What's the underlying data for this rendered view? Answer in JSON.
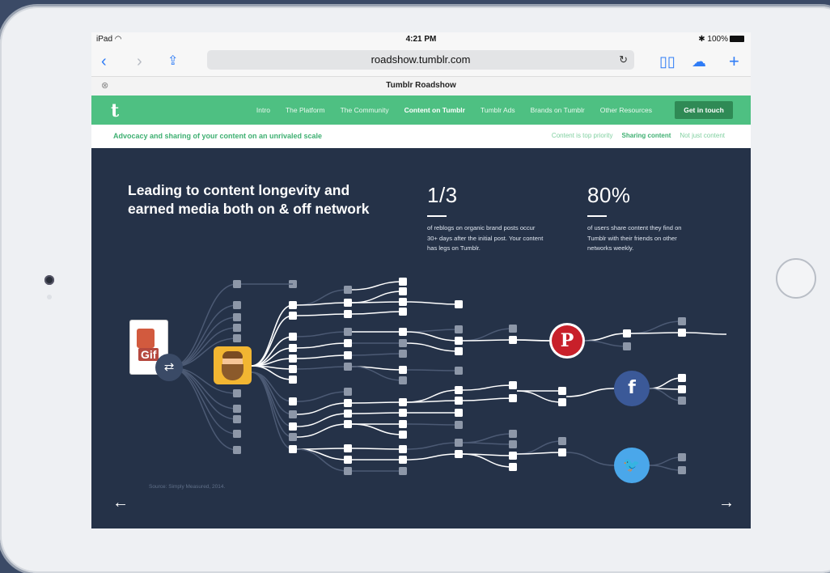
{
  "status_bar": {
    "device": "iPad",
    "time": "4:21 PM",
    "battery": "100%"
  },
  "browser": {
    "url": "roadshow.tumblr.com",
    "tab_title": "Tumblr Roadshow",
    "icons": [
      "back-icon",
      "forward-icon",
      "share-icon",
      "reload-icon",
      "bookmarks-icon",
      "icloud-tabs-icon",
      "new-tab-icon",
      "tab-close-icon"
    ]
  },
  "site_nav": {
    "logo": "t",
    "items": [
      "Intro",
      "The Platform",
      "The Community",
      "Content on Tumblr",
      "Tumblr Ads",
      "Brands on Tumblr",
      "Other Resources"
    ],
    "active_index": 3,
    "cta": "Get in touch",
    "brand_color": "#4ec082"
  },
  "subnav": {
    "tagline": "Advocacy and sharing of your content on an unrivaled scale",
    "links": [
      "Content is top priority",
      "Sharing content",
      "Not just content"
    ],
    "active_index": 1
  },
  "content": {
    "headline_line1": "Leading to content longevity and",
    "headline_line2": "earned media both on & off network",
    "stats": [
      {
        "value": "1/3",
        "desc_lines": [
          "of reblogs on organic brand posts occur",
          "30+ days after the initial post. Your content",
          "has legs on Tumblr."
        ]
      },
      {
        "value": "80%",
        "desc_lines": [
          "of users share content they find on",
          "Tumblr with their friends on other",
          "networks weekly."
        ]
      }
    ],
    "source": "Source: Simply Measured, 2014.",
    "gif_label": "Gif",
    "social_icons": {
      "pinterest": "P",
      "facebook": "f",
      "twitter": "🐦"
    },
    "nav_prev": "←",
    "nav_next": "→"
  }
}
